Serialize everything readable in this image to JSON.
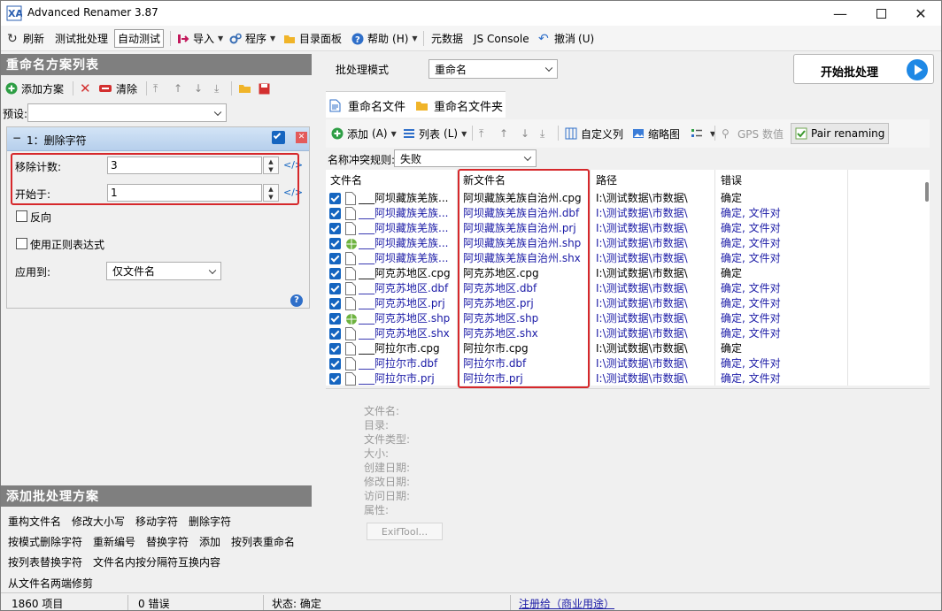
{
  "window": {
    "title": "Advanced Renamer 3.87"
  },
  "toolbar": {
    "refresh": "刷新",
    "test_batch": "测试批处理",
    "auto_test": "自动测试",
    "import": "导入",
    "program": "程序",
    "dir_panel": "目录面板",
    "help": "帮助",
    "help_key": "(H)",
    "metadata": "元数据",
    "js_console": "JS Console",
    "undo": "撤消",
    "undo_key": "(U)"
  },
  "left": {
    "section_title": "重命名方案列表",
    "add_method": "添加方案",
    "clear": "清除",
    "preset_label": "预设:",
    "preset_value": "",
    "method": {
      "header": "1：删除字符",
      "remove_count_label": "移除计数:",
      "remove_count": "3",
      "start_at_label": "开始于:",
      "start_at": "1",
      "reverse_label": "反向",
      "regex_label": "使用正则表达式",
      "apply_to_label": "应用到:",
      "apply_to_value": "仅文件名"
    },
    "add_section_title": "添加批处理方案",
    "method_links": [
      [
        "重构文件名",
        "修改大小写",
        "移动字符",
        "删除字符"
      ],
      [
        "按模式删除字符",
        "重新编号",
        "替换字符",
        "添加",
        "按列表重命名"
      ],
      [
        "按列表替换字符",
        "文件名内按分隔符互换内容"
      ],
      [
        "从文件名两端修剪"
      ]
    ]
  },
  "right": {
    "batch_mode_label": "批处理模式",
    "batch_mode_value": "重命名",
    "start_button": "开始批处理",
    "tabs": [
      "重命名文件",
      "重命名文件夹"
    ],
    "toolbar": {
      "add": "添加",
      "add_key": "(A)",
      "list": "列表",
      "list_key": "(L)",
      "custom_columns": "自定义列",
      "thumbnail": "缩略图",
      "gps": "GPS 数值",
      "pair": "Pair renaming"
    },
    "conflict_label": "名称冲突规则:",
    "conflict_value": "失败",
    "columns": [
      "文件名",
      "新文件名",
      "路径",
      "错误"
    ],
    "rows": [
      {
        "name": "___阿坝藏族羌族...",
        "newname": "阿坝藏族羌族自治州.cpg",
        "path": "I:\\测试数据\\市数据\\",
        "error": "确定",
        "icon": "file",
        "blue": false
      },
      {
        "name": "___阿坝藏族羌族...",
        "newname": "阿坝藏族羌族自治州.dbf",
        "path": "I:\\测试数据\\市数据\\",
        "error": "确定, 文件对",
        "icon": "file",
        "blue": true
      },
      {
        "name": "___阿坝藏族羌族...",
        "newname": "阿坝藏族羌族自治州.prj",
        "path": "I:\\测试数据\\市数据\\",
        "error": "确定, 文件对",
        "icon": "file",
        "blue": true
      },
      {
        "name": "___阿坝藏族羌族...",
        "newname": "阿坝藏族羌族自治州.shp",
        "path": "I:\\测试数据\\市数据\\",
        "error": "确定, 文件对",
        "icon": "globe",
        "blue": true
      },
      {
        "name": "___阿坝藏族羌族...",
        "newname": "阿坝藏族羌族自治州.shx",
        "path": "I:\\测试数据\\市数据\\",
        "error": "确定, 文件对",
        "icon": "file",
        "blue": true
      },
      {
        "name": "___阿克苏地区.cpg",
        "newname": "阿克苏地区.cpg",
        "path": "I:\\测试数据\\市数据\\",
        "error": "确定",
        "icon": "file",
        "blue": false
      },
      {
        "name": "___阿克苏地区.dbf",
        "newname": "阿克苏地区.dbf",
        "path": "I:\\测试数据\\市数据\\",
        "error": "确定, 文件对",
        "icon": "file",
        "blue": true
      },
      {
        "name": "___阿克苏地区.prj",
        "newname": "阿克苏地区.prj",
        "path": "I:\\测试数据\\市数据\\",
        "error": "确定, 文件对",
        "icon": "file",
        "blue": true
      },
      {
        "name": "___阿克苏地区.shp",
        "newname": "阿克苏地区.shp",
        "path": "I:\\测试数据\\市数据\\",
        "error": "确定, 文件对",
        "icon": "globe",
        "blue": true
      },
      {
        "name": "___阿克苏地区.shx",
        "newname": "阿克苏地区.shx",
        "path": "I:\\测试数据\\市数据\\",
        "error": "确定, 文件对",
        "icon": "file",
        "blue": true
      },
      {
        "name": "___阿拉尔市.cpg",
        "newname": "阿拉尔市.cpg",
        "path": "I:\\测试数据\\市数据\\",
        "error": "确定",
        "icon": "file",
        "blue": false
      },
      {
        "name": "___阿拉尔市.dbf",
        "newname": "阿拉尔市.dbf",
        "path": "I:\\测试数据\\市数据\\",
        "error": "确定, 文件对",
        "icon": "file",
        "blue": true
      },
      {
        "name": "___阿拉尔市.prj",
        "newname": "阿拉尔市.prj",
        "path": "I:\\测试数据\\市数据\\",
        "error": "确定, 文件对",
        "icon": "file",
        "blue": true
      }
    ],
    "info_labels": [
      "文件名:",
      "目录:",
      "文件类型:",
      "大小:",
      "创建日期:",
      "修改日期:",
      "访问日期:",
      "属性:"
    ],
    "exiftool": "ExifTool..."
  },
  "status": {
    "items": "1860 项目",
    "errors": "0 错误",
    "state": "状态: 确定",
    "register": "注册给（商业用途）"
  },
  "colors": {
    "header_gray": "#7f7f7f",
    "accent_blue": "#1565c0",
    "highlight_red": "#d6282b",
    "paired_text": "#1a1aa6"
  }
}
